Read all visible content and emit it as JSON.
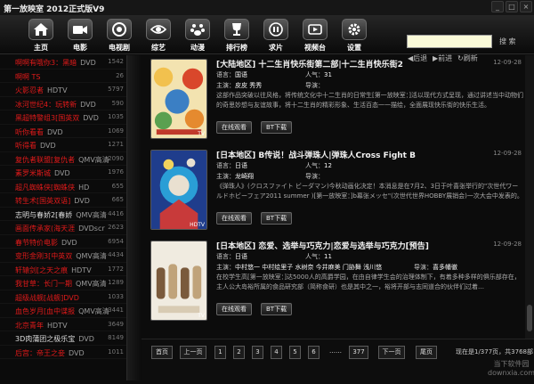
{
  "app": {
    "title": "第一放映室 2012正式版V9",
    "window_buttons": [
      "_",
      "□",
      "×"
    ]
  },
  "nav": [
    {
      "label": "主页",
      "icon": "home-icon"
    },
    {
      "label": "电影",
      "icon": "camera-icon"
    },
    {
      "label": "电视剧",
      "icon": "tv-icon"
    },
    {
      "label": "综艺",
      "icon": "eye-icon"
    },
    {
      "label": "动漫",
      "icon": "paw-icon"
    },
    {
      "label": "排行榜",
      "icon": "trophy-icon"
    },
    {
      "label": "求片",
      "icon": "pause-icon"
    },
    {
      "label": "视频台",
      "icon": "video-icon"
    },
    {
      "label": "设置",
      "icon": "gear-icon"
    }
  ],
  "search": {
    "value": "",
    "button": "搜 索"
  },
  "history": {
    "back": "后退",
    "forward": "前进",
    "refresh": "刷新"
  },
  "sidebar": [
    {
      "name": "啊啊有哦你3：黑暗",
      "extra": "DVD",
      "count": "1542",
      "highlight": true
    },
    {
      "name": "啊啊 TS",
      "extra": "",
      "count": "26",
      "highlight": true
    },
    {
      "name": "火影忍者",
      "extra": "HDTV",
      "count": "5797",
      "highlight": true
    },
    {
      "name": "冰河世纪4：玩转新",
      "extra": "DVD",
      "count": "590",
      "highlight": true
    },
    {
      "name": "黑超特警组3[国英双",
      "extra": "DVD",
      "count": "1035",
      "highlight": true
    },
    {
      "name": "听你看看",
      "extra": "DVD",
      "count": "1069",
      "highlight": true
    },
    {
      "name": "听得看",
      "extra": "DVD",
      "count": "1271",
      "highlight": true
    },
    {
      "name": "复仇者联盟[复仇者",
      "extra": "QMV高清",
      "count": "2090",
      "highlight": true
    },
    {
      "name": "素罗米斯城",
      "extra": "DVD",
      "count": "1976",
      "highlight": true
    },
    {
      "name": "超凡蜘蛛侠[蜘蛛侠",
      "extra": "HD",
      "count": "655",
      "highlight": true
    },
    {
      "name": "转生术[国英双语]",
      "extra": "DVD",
      "count": "665",
      "highlight": true
    },
    {
      "name": "志明与春娇2[春娇",
      "extra": "QMV高清",
      "count": "4416",
      "highlight": false
    },
    {
      "name": "画面传承家(海天涯",
      "extra": "DVDscr",
      "count": "2623",
      "highlight": true
    },
    {
      "name": "春节特价电影",
      "extra": "DVD",
      "count": "6954",
      "highlight": true
    },
    {
      "name": "变形金刚3[中英双",
      "extra": "QMV高清",
      "count": "4434",
      "highlight": true
    },
    {
      "name": "轩辕剑[之天之痕",
      "extra": "HDTV",
      "count": "1772",
      "highlight": true
    },
    {
      "name": "我甘草：长门一期",
      "extra": "QMV高清",
      "count": "1289",
      "highlight": true
    },
    {
      "name": "超级战舰[战舰]DVD",
      "extra": "",
      "count": "1033",
      "highlight": true
    },
    {
      "name": "血色岁月[血中谍报",
      "extra": "QMV高清",
      "count": "3441",
      "highlight": true
    },
    {
      "name": "北京青年",
      "extra": "HDTV",
      "count": "3649",
      "highlight": true
    },
    {
      "name": "3D肉蒲团之极乐宝",
      "extra": "DVD",
      "count": "8149",
      "highlight": false
    },
    {
      "name": "后宫：帝王之妾",
      "extra": "DVD",
      "count": "1011",
      "highlight": true
    }
  ],
  "movies": [
    {
      "title": "[大陆地区] 十二生肖快乐街第二部|十二生肖快乐街2",
      "date": "12-09-28",
      "language_label": "语言：",
      "language": "国语",
      "popularity_label": "人气：",
      "popularity": "31",
      "cast_label": "主演：",
      "cast": "皮皮 秀秀",
      "director_label": "导演：",
      "director": "",
      "description": "这部作品突破以往风格，将传统文化中十二生肖的日常生[第一放映室：]活以现代方式呈现，通过讲述当中动物们的奇思妙想与友谊故事，将十二生肖的精彩形象、生活百态一一描绘，全面展现快乐街的快乐生活。",
      "poster_tag": "TV",
      "online_button": "在线观看",
      "bt_button": "BT下载",
      "palette": [
        "#f2c14e",
        "#d9472b",
        "#3b7fc4",
        "#5aa050"
      ]
    },
    {
      "title": "[日本地区] B传说！战斗弹珠人|弹珠人Cross Fight B",
      "date": "12-09-28",
      "language_label": "语言：",
      "language": "日语",
      "popularity_label": "人气：",
      "popularity": "12",
      "cast_label": "主演：",
      "cast": "龙崎翔",
      "director_label": "导演：",
      "director": "",
      "description": "《弹珠人》(クロスファイト ビーダマン)今秋动画化决定！本消息是在7月2、3日于叶喜张举行的\"次世代ワールドホビーフェア2011 summer )[第一放映室：]b幕张メッセ\"(次世代世界HOBBY展销会)一次大会中发表的。",
      "poster_tag": "HDTV",
      "online_button": "在线观看",
      "bt_button": "BT下载",
      "palette": [
        "#1f3d8c",
        "#c83a3a",
        "#e9e0d0",
        "#2a9ed6"
      ]
    },
    {
      "title": "[日本地区] 恋爱、选举与巧克力|恋爱与选举与巧克力[预告]",
      "date": "12-09-28",
      "language_label": "语言：",
      "language": "日语",
      "popularity_label": "人气：",
      "popularity": "11",
      "cast_label": "主演：",
      "cast": "中村悠一 中村绘里子 水树奈 今井麻美 门胁舞 浅川悠",
      "director_label": "导演：",
      "director": "喜多幡徹",
      "description": "在校学生高[第一放映室：]达5000人的高爵学园，在由自律学生会的治理体制下，有着多种多样的俱乐部存在，主人公大岛裕所属的食品研究部（简称食研）也是其中之一，裕将开部与志同道合的伙伴们过着…",
      "poster_tag": "TV",
      "online_button": "在线观看",
      "bt_button": "BT下载",
      "palette": [
        "#f0ebe0",
        "#c0a37a",
        "#7a5a3c",
        "#e6e0d8"
      ]
    }
  ],
  "pager": {
    "first": "首页",
    "prev": "上一页",
    "pages": [
      "1",
      "2",
      "3",
      "4",
      "5",
      "6"
    ],
    "ellipsis": "……",
    "last_page": "377",
    "next": "下一页",
    "end": "尾页",
    "info": "现在是1/377页，共3768部"
  },
  "watermark": {
    "line1": "当下软件园",
    "line2": "downxia.com"
  },
  "colors": {
    "accent_red": "#e01a1a",
    "background": "#0c0c0c",
    "search_bg": "#fafad8"
  }
}
